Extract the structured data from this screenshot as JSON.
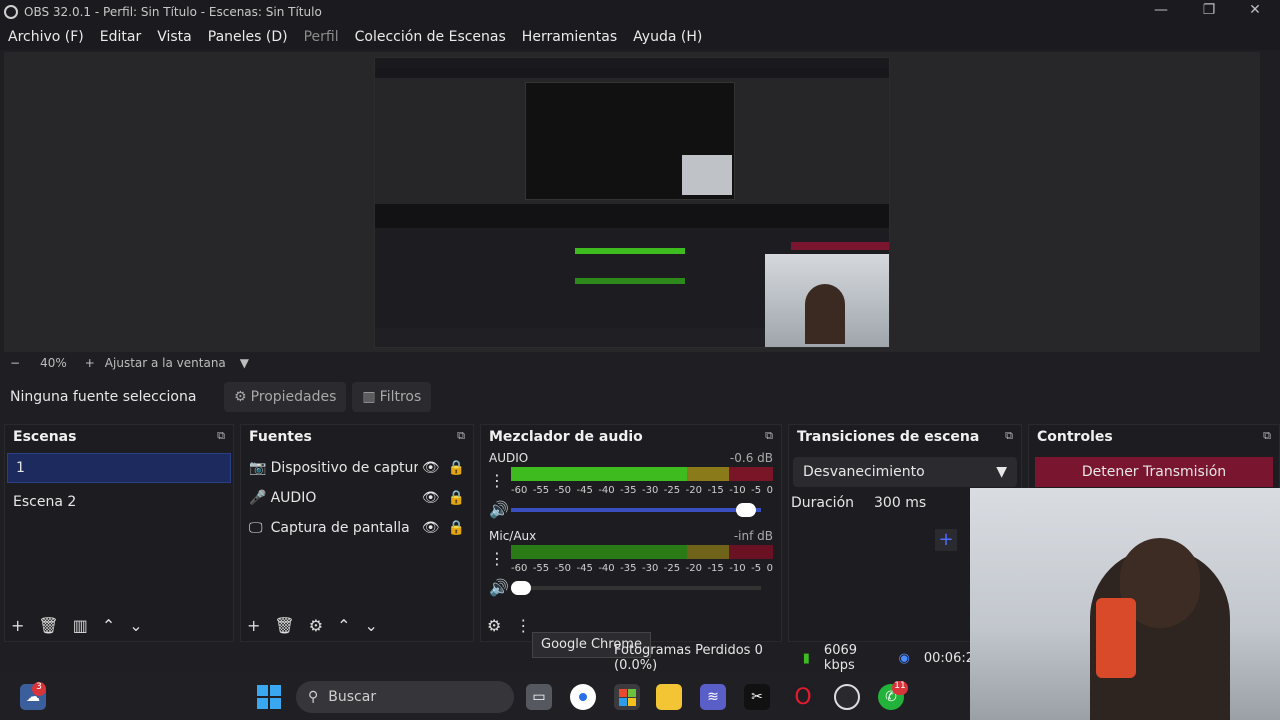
{
  "window": {
    "title": "OBS 32.0.1 - Perfil: Sin Título - Escenas: Sin Título",
    "minimize": "—",
    "maximize": "❐",
    "close": "✕"
  },
  "menu": [
    "Archivo (F)",
    "Editar",
    "Vista",
    "Paneles (D)",
    "Perfil",
    "Colección de Escenas",
    "Herramientas",
    "Ayuda (H)"
  ],
  "zoom": {
    "minus": "−",
    "value": "40%",
    "plus": "+",
    "fit_label": "Ajustar a la ventana"
  },
  "source_bar": {
    "no_source": "Ninguna fuente selecciona",
    "properties": "Propiedades",
    "filters": "Filtros"
  },
  "scenes": {
    "title": "Escenas",
    "items": [
      "1",
      "Escena 2"
    ]
  },
  "sources": {
    "title": "Fuentes",
    "items": [
      {
        "label": "Dispositivo de captura d",
        "icon": "camera-icon"
      },
      {
        "label": "AUDIO",
        "icon": "microphone-icon"
      },
      {
        "label": "Captura de pantalla",
        "icon": "monitor-icon"
      }
    ]
  },
  "mixer": {
    "title": "Mezclador de audio",
    "ticks": [
      "-60",
      "-55",
      "-50",
      "-45",
      "-40",
      "-35",
      "-30",
      "-25",
      "-20",
      "-15",
      "-10",
      "-5",
      "0"
    ],
    "channels": [
      {
        "name": "AUDIO",
        "db": "-0.6 dB",
        "volume_fraction": 0.98
      },
      {
        "name": "Mic/Aux",
        "db": "-inf dB",
        "volume_fraction": 0.0
      }
    ]
  },
  "transitions": {
    "title": "Transiciones de escena",
    "selected": "Desvanecimiento",
    "duration_label": "Duración",
    "duration_value": "300 ms"
  },
  "controls": {
    "title": "Controles",
    "stop_stream": "Detener Transmisión"
  },
  "status": {
    "dropped": "Fotogramas Perdidos 0 (0.0%)",
    "bitrate": "6069 kbps",
    "time": "00:06:2"
  },
  "tooltip": "Google Chrome",
  "taskbar": {
    "search_placeholder": "Buscar",
    "badge_weather": "3",
    "badge_whatsapp": "11"
  },
  "colors": {
    "accent_stop": "#7a1530",
    "meter_green": "#3dbb1f",
    "meter_yellow": "#c9a61a",
    "meter_red": "#c2213a",
    "selected_bg": "#1c2a5e"
  }
}
